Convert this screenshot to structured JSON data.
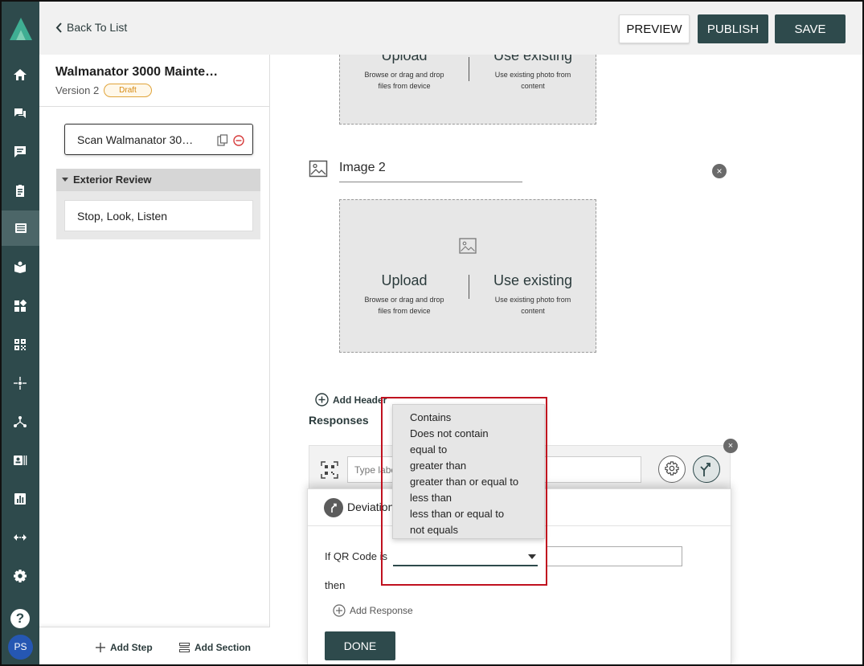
{
  "nav": {
    "back_label": "Back To List",
    "items": [
      "home-icon",
      "chat-icon",
      "feedback-icon",
      "clipboard-icon",
      "procedures-icon",
      "book-icon",
      "dashboard-icon",
      "qr-code-icon",
      "sparkle-icon",
      "hierarchy-icon",
      "contacts-icon",
      "analytics-icon",
      "integrations-icon",
      "settings-icon"
    ],
    "help_label": "?",
    "avatar_initials": "PS"
  },
  "header": {
    "preview_label": "PREVIEW",
    "publish_label": "PUBLISH",
    "save_label": "SAVE"
  },
  "procedure": {
    "title": "Walmanator 3000 Mainte…",
    "version": "Version 2",
    "status": "Draft",
    "active_step": "Scan Walmanator 30…",
    "section_title": "Exterior Review",
    "section_steps": [
      "Stop, Look, Listen"
    ],
    "add_step_label": "Add Step",
    "add_section_label": "Add Section"
  },
  "images": {
    "upload_title": "Upload",
    "upload_sub_line1": "Browse or drag and drop",
    "upload_sub_line2": "files from device",
    "existing_title": "Use existing",
    "existing_sub_line1": "Use existing photo from",
    "existing_sub_line2": "content",
    "image2_name": "Image 2"
  },
  "responses": {
    "add_header_label": "Add Header",
    "title": "Responses",
    "type_label_placeholder": "Type label",
    "close_symbol": "×"
  },
  "deviation": {
    "title": "Deviation",
    "if_label": "If QR Code is",
    "then_label": "then",
    "add_response_label": "Add Response",
    "done_label": "DONE",
    "options": [
      "Contains",
      "Does not contain",
      "equal to",
      "greater than",
      "greater than or equal to",
      "less than",
      "less than or equal to",
      "not equals"
    ]
  },
  "colors": {
    "brand_dark": "#2e4a4c",
    "highlight": "#c0111f",
    "draft_badge": "#e0a43a"
  }
}
